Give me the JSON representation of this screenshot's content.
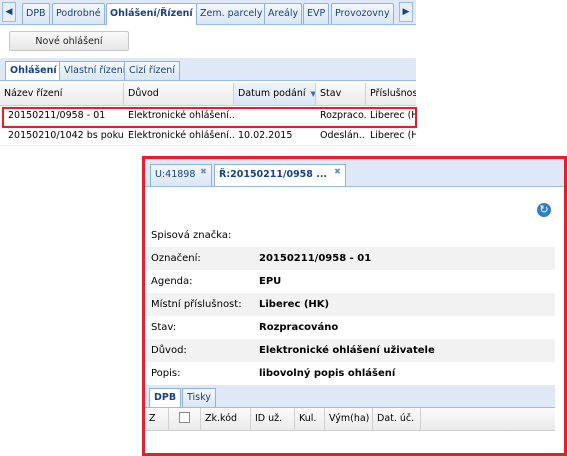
{
  "top_tabs": {
    "prev_arrow": "◀",
    "next_arrow": "▶",
    "items": [
      {
        "label": "DPB"
      },
      {
        "label": "Podrobné"
      },
      {
        "label": "Ohlášení/Řízení"
      },
      {
        "label": "Zem. parcely"
      },
      {
        "label": "Areály"
      },
      {
        "label": "EVP"
      },
      {
        "label": "Provozovny"
      }
    ]
  },
  "toolbar": {
    "new_button": "Nové ohlášení"
  },
  "sub_tabs": {
    "items": [
      {
        "label": "Ohlášení"
      },
      {
        "label": "Vlastní řízení"
      },
      {
        "label": "Cizí řízení"
      }
    ]
  },
  "grid": {
    "columns": [
      "Název řízení",
      "Důvod",
      "Datum podání",
      "Stav",
      "Příslušnost"
    ],
    "sort_icon": "▼",
    "rows": [
      {
        "name": "20150211/0958 - 01",
        "reason": "Elektronické ohlášení...",
        "date": "",
        "state": "Rozpraco...",
        "locality": "Liberec (HK)"
      },
      {
        "name": "20150210/1042 bs pokus",
        "reason": "Elektronické ohlášení...",
        "date": "10.02.2015",
        "state": "Odeslán...",
        "locality": "Liberec (HK)"
      }
    ]
  },
  "detail": {
    "tabs": [
      {
        "label": "U:41898"
      },
      {
        "label": "Ř:20150211/0958 ..."
      }
    ],
    "close_icon": "✖",
    "refresh_icon": "↻",
    "fields": [
      {
        "label": "Spisová značka:",
        "value": ""
      },
      {
        "label": "Označení:",
        "value": "20150211/0958 - 01"
      },
      {
        "label": "Agenda:",
        "value": "EPU"
      },
      {
        "label": "Místní příslušnost:",
        "value": "Liberec (HK)"
      },
      {
        "label": "Stav:",
        "value": "Rozpracováno"
      },
      {
        "label": "Důvod:",
        "value": "Elektronické ohlášení uživatele"
      },
      {
        "label": "Popis:",
        "value": "libovolný popis ohlášení"
      }
    ],
    "bottom_tabs": [
      {
        "label": "DPB"
      },
      {
        "label": "Tisky"
      }
    ],
    "bottom_columns": [
      "Z",
      "",
      "Zk.kód",
      "ID už.",
      "Kul.",
      "Vým(ha)",
      "Dat. úč."
    ]
  },
  "colors": {
    "highlight": "#e2202a",
    "tab_text": "#15428b",
    "tab_bg": "#dfe8f6"
  }
}
